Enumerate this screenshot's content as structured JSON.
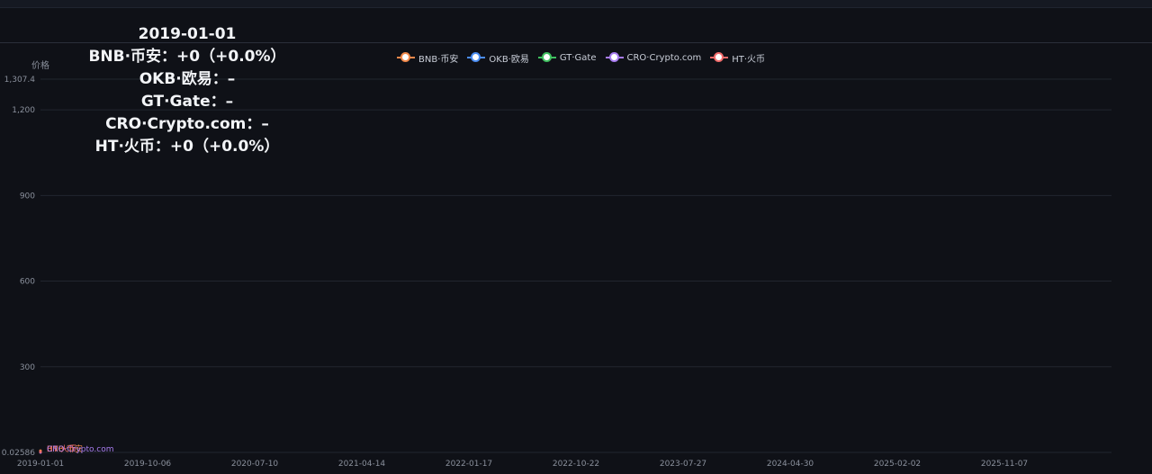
{
  "tooltip": {
    "date": "2019-01-01",
    "lines": [
      "BNB·币安：+0（+0.0%）",
      "OKB·欧易：–",
      "GT·Gate：–",
      "CRO·Crypto.com：–",
      "HT·火币：+0（+0.0%）"
    ]
  },
  "colors": {
    "background": "#0f1117",
    "grid": "#22262f",
    "axis_text": "#8a909c"
  },
  "chart_data": {
    "type": "line",
    "title": "",
    "ylabel": "价格",
    "xlabel": "",
    "ylim": [
      0.02586,
      1307.4
    ],
    "y_ticks": [
      "1,307.4",
      "1,200",
      "900",
      "600",
      "300",
      "0.02586"
    ],
    "y_tick_values": [
      1307.4,
      1200,
      900,
      600,
      300,
      0.02586
    ],
    "x_ticks": [
      "2019-01-01",
      "2019-10-06",
      "2020-07-10",
      "2021-04-14",
      "2022-01-17",
      "2022-10-22",
      "2023-07-27",
      "2024-04-30",
      "2025-02-02",
      "2025-11-07"
    ],
    "xlim": [
      "2019-01-01",
      "2026-08-12"
    ],
    "grid": true,
    "legend_position": "top",
    "series": [
      {
        "name": "BNB·币安",
        "color": "#f0884a",
        "points": [
          [
            "2019-01-01",
            6.1
          ]
        ]
      },
      {
        "name": "OKB·欧易",
        "color": "#4a8cf0",
        "points": []
      },
      {
        "name": "GT·Gate",
        "color": "#3fbf5f",
        "points": []
      },
      {
        "name": "CRO·Crypto.com",
        "color": "#a87cf0",
        "points": [
          [
            "2019-01-01",
            0.02586
          ]
        ]
      },
      {
        "name": "HT·火币",
        "color": "#f06a6a",
        "points": [
          [
            "2019-01-01",
            1.9
          ]
        ]
      }
    ],
    "end_labels": [
      "BNB·币安",
      "HT·火币",
      "CRO·Crypto.com"
    ]
  }
}
